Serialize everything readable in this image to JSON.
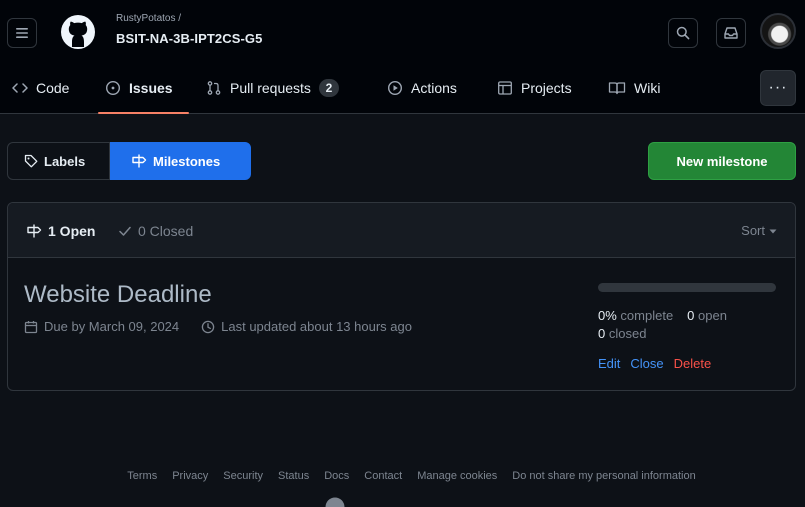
{
  "header": {
    "owner": "RustyPotatos /",
    "repo": "BSIT-NA-3B-IPT2CS-G5"
  },
  "nav": {
    "code": "Code",
    "issues": "Issues",
    "pull_requests": "Pull requests",
    "pull_requests_count": "2",
    "actions": "Actions",
    "projects": "Projects",
    "wiki": "Wiki",
    "more": "···"
  },
  "subnav": {
    "labels": "Labels",
    "milestones": "Milestones",
    "new_milestone": "New milestone"
  },
  "states": {
    "open": "1 Open",
    "closed": "0 Closed",
    "sort": "Sort"
  },
  "milestone": {
    "title": "Website Deadline",
    "due": "Due by March 09, 2024",
    "updated": "Last updated about 13 hours ago",
    "progress": 0,
    "complete": "0%",
    "complete_label": "complete",
    "open": "0",
    "open_label": "open",
    "closed": "0",
    "closed_label": "closed",
    "edit": "Edit",
    "close": "Close",
    "delete": "Delete"
  },
  "footer": {
    "links": [
      "Terms",
      "Privacy",
      "Security",
      "Status",
      "Docs",
      "Contact",
      "Manage cookies",
      "Do not share my personal information"
    ]
  },
  "colors": {
    "accent": "#1f6feb",
    "primary_button": "#238636",
    "danger": "#f85149",
    "underline": "#f78166"
  }
}
